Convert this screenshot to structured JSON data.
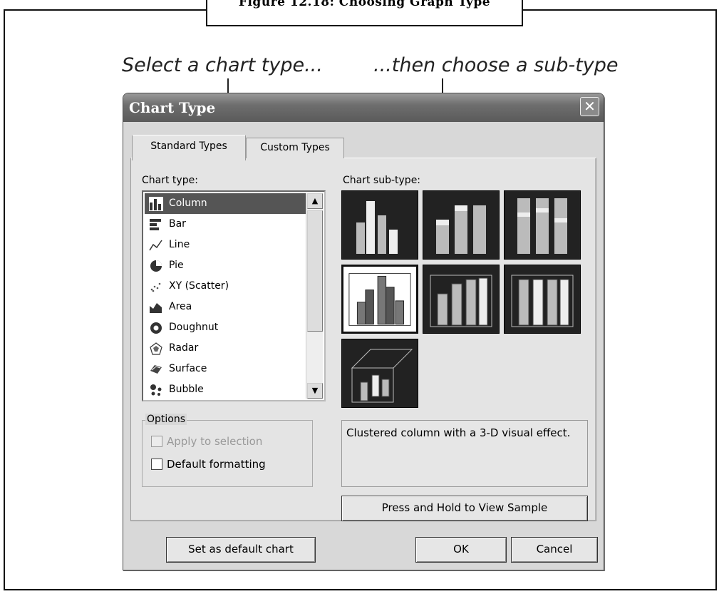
{
  "figure": {
    "caption": "Figure 12.18: Choosing Graph Type",
    "annotation_left": "Select a chart type...",
    "annotation_right": "...then choose a sub-type"
  },
  "dialog": {
    "title": "Chart Type",
    "close_glyph": "✕",
    "tabs": [
      "Standard Types",
      "Custom Types"
    ],
    "chart_type_label": "Chart type:",
    "subtype_label": "Chart sub-type:",
    "chart_types": [
      {
        "label": "Column",
        "icon": "column-chart-icon",
        "selected": true
      },
      {
        "label": "Bar",
        "icon": "bar-chart-icon"
      },
      {
        "label": "Line",
        "icon": "line-chart-icon"
      },
      {
        "label": "Pie",
        "icon": "pie-chart-icon"
      },
      {
        "label": "XY (Scatter)",
        "icon": "scatter-chart-icon"
      },
      {
        "label": "Area",
        "icon": "area-chart-icon"
      },
      {
        "label": "Doughnut",
        "icon": "doughnut-chart-icon"
      },
      {
        "label": "Radar",
        "icon": "radar-chart-icon"
      },
      {
        "label": "Surface",
        "icon": "surface-chart-icon"
      },
      {
        "label": "Bubble",
        "icon": "bubble-chart-icon"
      }
    ],
    "subtypes": [
      {
        "icon": "clustered-column-icon"
      },
      {
        "icon": "stacked-column-icon"
      },
      {
        "icon": "100-stacked-column-icon"
      },
      {
        "icon": "3d-clustered-column-icon",
        "selected": true
      },
      {
        "icon": "3d-stacked-column-icon"
      },
      {
        "icon": "3d-100-stacked-column-icon"
      },
      {
        "icon": "3d-column-icon"
      }
    ],
    "options": {
      "legend": "Options",
      "apply_to_selection": "Apply to selection",
      "default_formatting": "Default formatting"
    },
    "description": "Clustered column with a 3-D visual effect.",
    "sample_button": "Press and Hold to View Sample",
    "set_default_button": "Set as default chart",
    "ok_button": "OK",
    "cancel_button": "Cancel"
  }
}
